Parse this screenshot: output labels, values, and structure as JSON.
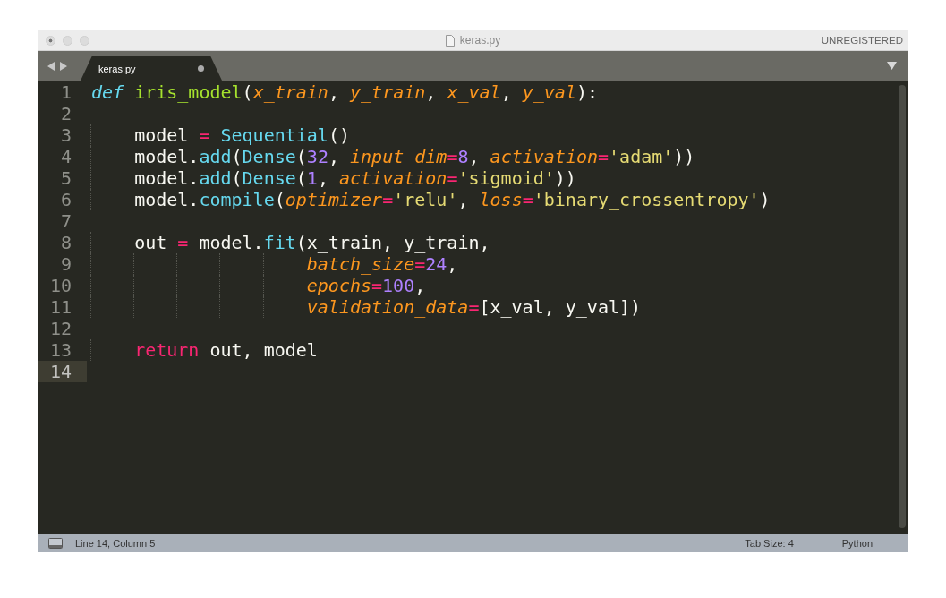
{
  "window": {
    "title": "keras.py",
    "license_label": "UNREGISTERED"
  },
  "tabs": [
    {
      "label": "keras.py",
      "selected": true,
      "modified": true
    }
  ],
  "editor": {
    "lines": [
      {
        "number": "1",
        "current": false,
        "tokens": [
          {
            "kind": "storage",
            "text": "def"
          },
          {
            "kind": "function",
            "text": "iris_model",
            "space_before": true
          },
          {
            "kind": "plain",
            "text": "("
          },
          {
            "kind": "param",
            "text": "x_train"
          },
          {
            "kind": "plain",
            "text": ", "
          },
          {
            "kind": "param",
            "text": "y_train"
          },
          {
            "kind": "plain",
            "text": ", "
          },
          {
            "kind": "param",
            "text": "x_val"
          },
          {
            "kind": "plain",
            "text": ", "
          },
          {
            "kind": "param",
            "text": "y_val"
          },
          {
            "kind": "plain",
            "text": "):"
          }
        ]
      },
      {
        "number": "2",
        "current": false
      },
      {
        "number": "3",
        "current": false,
        "kind": "block",
        "tokens": [
          {
            "kind": "plain",
            "text": "model"
          },
          {
            "kind": "operator",
            "text": "=",
            "space_before": true
          },
          {
            "kind": "call",
            "text": "Sequential",
            "space_before": true
          },
          {
            "kind": "plain",
            "text": "()"
          }
        ]
      },
      {
        "number": "4",
        "current": false,
        "kind": "block",
        "tokens": [
          {
            "kind": "plain",
            "text": "model."
          },
          {
            "kind": "call",
            "text": "add"
          },
          {
            "kind": "plain",
            "text": "("
          },
          {
            "kind": "call",
            "text": "Dense"
          },
          {
            "kind": "plain",
            "text": "("
          },
          {
            "kind": "number",
            "text": "32"
          },
          {
            "kind": "plain",
            "text": ", "
          },
          {
            "kind": "param",
            "text": "input_dim"
          },
          {
            "kind": "operator",
            "text": "="
          },
          {
            "kind": "number",
            "text": "8"
          },
          {
            "kind": "plain",
            "text": ", "
          },
          {
            "kind": "param",
            "text": "activation"
          },
          {
            "kind": "operator",
            "text": "="
          },
          {
            "kind": "string",
            "text": "'adam'"
          },
          {
            "kind": "plain",
            "text": "))"
          }
        ]
      },
      {
        "number": "5",
        "current": false,
        "kind": "block",
        "tokens": [
          {
            "kind": "plain",
            "text": "model."
          },
          {
            "kind": "call",
            "text": "add"
          },
          {
            "kind": "plain",
            "text": "("
          },
          {
            "kind": "call",
            "text": "Dense"
          },
          {
            "kind": "plain",
            "text": "("
          },
          {
            "kind": "number",
            "text": "1"
          },
          {
            "kind": "plain",
            "text": ", "
          },
          {
            "kind": "param",
            "text": "activation"
          },
          {
            "kind": "operator",
            "text": "="
          },
          {
            "kind": "string",
            "text": "'sigmoid'"
          },
          {
            "kind": "plain",
            "text": "))"
          }
        ]
      },
      {
        "number": "6",
        "current": false,
        "kind": "block",
        "tokens": [
          {
            "kind": "plain",
            "text": "model."
          },
          {
            "kind": "call",
            "text": "compile"
          },
          {
            "kind": "plain",
            "text": "("
          },
          {
            "kind": "param",
            "text": "optimizer"
          },
          {
            "kind": "operator",
            "text": "="
          },
          {
            "kind": "string",
            "text": "'relu'"
          },
          {
            "kind": "plain",
            "text": ", "
          },
          {
            "kind": "param",
            "text": "loss"
          },
          {
            "kind": "operator",
            "text": "="
          },
          {
            "kind": "string",
            "text": "'binary_crossentropy'"
          },
          {
            "kind": "plain",
            "text": ")"
          }
        ]
      },
      {
        "number": "7",
        "current": false
      },
      {
        "number": "8",
        "current": false,
        "kind": "block",
        "tokens": [
          {
            "kind": "plain",
            "text": "out"
          },
          {
            "kind": "operator",
            "text": "=",
            "space_before": true
          },
          {
            "kind": "plain",
            "text": " model."
          },
          {
            "kind": "call",
            "text": "fit"
          },
          {
            "kind": "plain",
            "text": "(x_train, y_train,"
          }
        ]
      },
      {
        "number": "9",
        "current": false,
        "kind": "continuation",
        "tokens": [
          {
            "kind": "param",
            "text": "batch_size"
          },
          {
            "kind": "operator",
            "text": "="
          },
          {
            "kind": "number",
            "text": "24"
          },
          {
            "kind": "plain",
            "text": ","
          }
        ]
      },
      {
        "number": "10",
        "current": false,
        "kind": "continuation",
        "tokens": [
          {
            "kind": "param",
            "text": "epochs"
          },
          {
            "kind": "operator",
            "text": "="
          },
          {
            "kind": "number",
            "text": "100"
          },
          {
            "kind": "plain",
            "text": ","
          }
        ]
      },
      {
        "number": "11",
        "current": false,
        "kind": "continuation",
        "tokens": [
          {
            "kind": "param",
            "text": "validation_data"
          },
          {
            "kind": "operator",
            "text": "="
          },
          {
            "kind": "plain",
            "text": "[x_val, y_val])"
          }
        ]
      },
      {
        "number": "12",
        "current": false
      },
      {
        "number": "13",
        "current": false,
        "kind": "block",
        "tokens": [
          {
            "kind": "keyword",
            "text": "return"
          },
          {
            "kind": "plain",
            "text": " out, model"
          }
        ]
      },
      {
        "number": "14",
        "current": true
      }
    ]
  },
  "status_bar": {
    "position": "Line 14, Column 5",
    "tab_size": "Tab Size: 4",
    "syntax": "Python"
  }
}
